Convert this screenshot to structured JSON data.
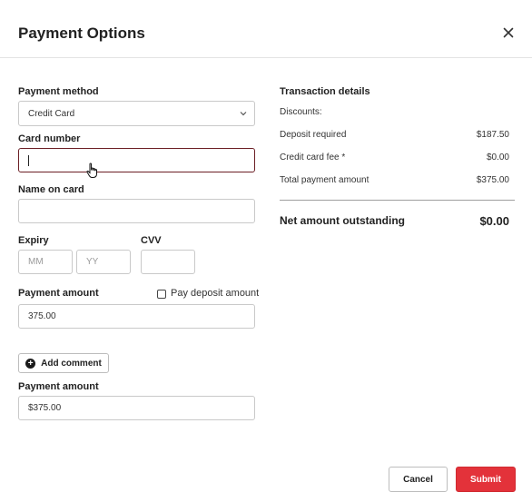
{
  "dialog": {
    "title": "Payment Options",
    "close_icon": "close-icon"
  },
  "form": {
    "payment_method": {
      "label": "Payment method",
      "value": "Credit Card"
    },
    "card_number": {
      "label": "Card number",
      "value": ""
    },
    "name_on_card": {
      "label": "Name on card",
      "value": ""
    },
    "expiry": {
      "label": "Expiry",
      "month_placeholder": "MM",
      "year_placeholder": "YY"
    },
    "cvv": {
      "label": "CVV",
      "value": ""
    },
    "payment_amount": {
      "label": "Payment amount",
      "value": "375.00"
    },
    "pay_deposit": {
      "label": "Pay deposit amount",
      "checked": false
    },
    "add_comment": {
      "label": "Add comment"
    },
    "payment_amount_2": {
      "label": "Payment amount",
      "value": "$375.00"
    }
  },
  "transaction": {
    "title": "Transaction details",
    "discounts_label": "Discounts:",
    "rows": [
      {
        "label": "Deposit required",
        "value": "$187.50"
      },
      {
        "label": "Credit card fee *",
        "value": "$0.00"
      },
      {
        "label": "Total payment amount",
        "value": "$375.00"
      }
    ],
    "net": {
      "label": "Net amount outstanding",
      "value": "$0.00"
    }
  },
  "footer": {
    "cancel_label": "Cancel",
    "submit_label": "Submit"
  },
  "colors": {
    "accent": "#e3323a",
    "focus_border": "#6b1e24"
  }
}
